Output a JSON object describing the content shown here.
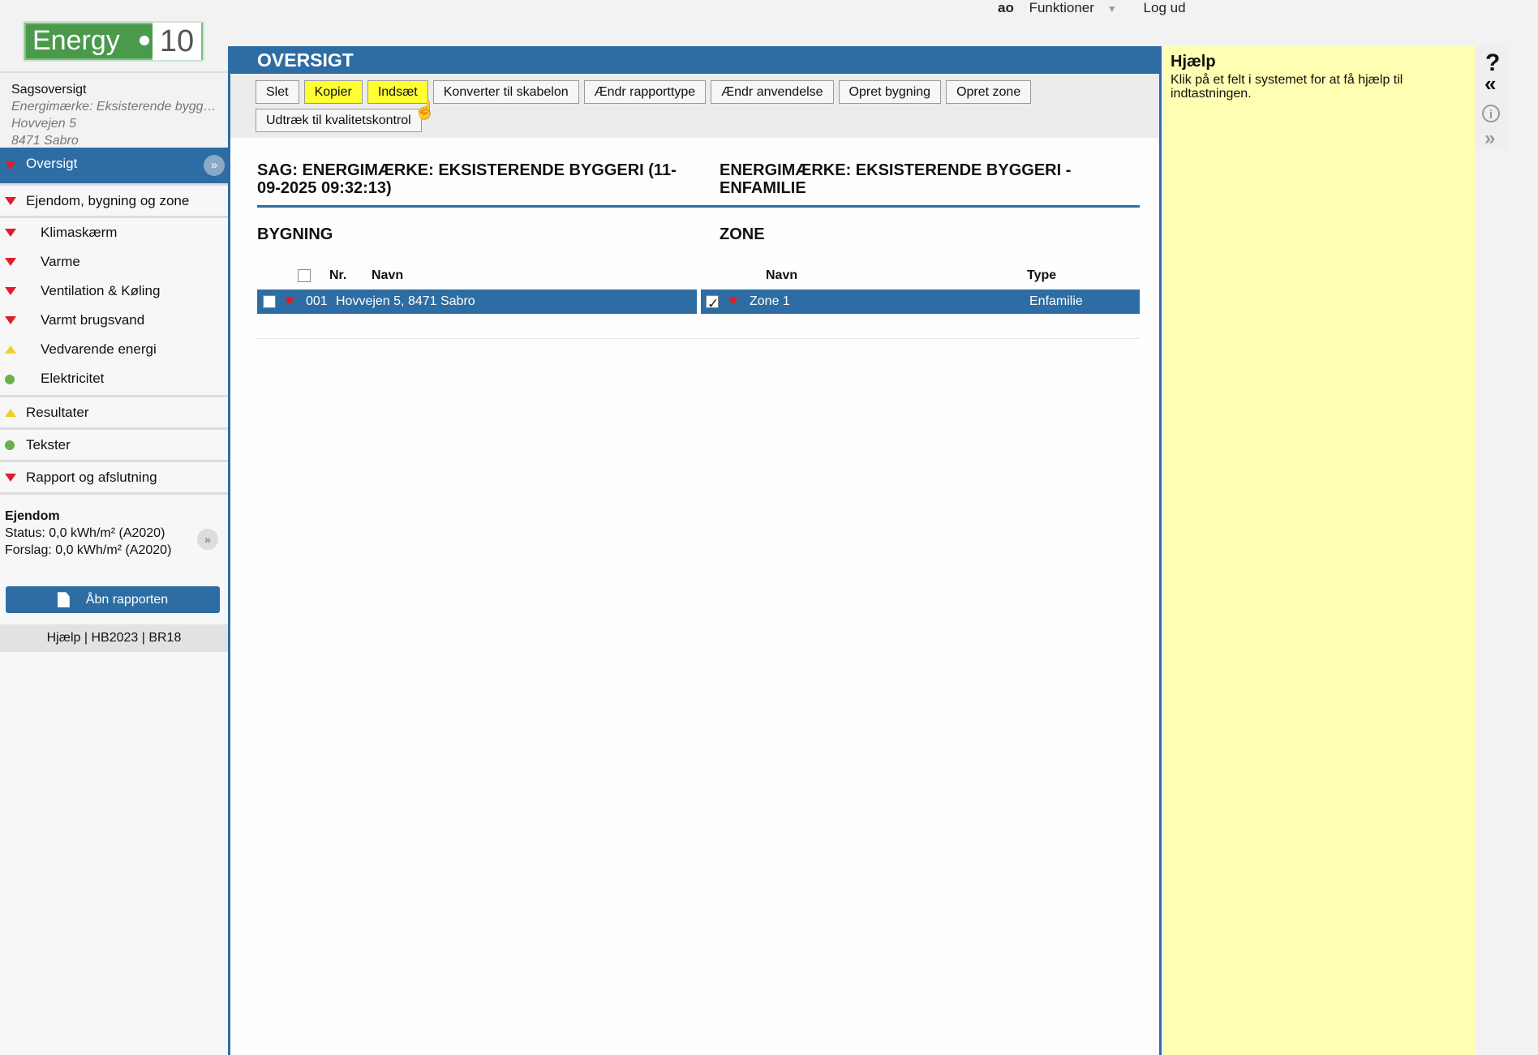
{
  "topbar": {
    "user": "ao",
    "functions": "Funktioner",
    "logout": "Log ud"
  },
  "logo": {
    "word": "Energy",
    "number": "10"
  },
  "case": {
    "title": "Sagsoversigt",
    "subtitle": "Energimærke: Eksisterende bygg…",
    "address1": "Hovvejen 5",
    "address2": "8471 Sabro"
  },
  "nav": {
    "oversigt": "Oversigt",
    "ejendom": "Ejendom, bygning og zone",
    "klimaskaerm": "Klimaskærm",
    "varme": "Varme",
    "ventilation": "Ventilation & Køling",
    "varmt": "Varmt brugsvand",
    "vedvarende": "Vedvarende energi",
    "elektricitet": "Elektricitet",
    "resultater": "Resultater",
    "tekster": "Tekster",
    "rapport": "Rapport og afslutning"
  },
  "property": {
    "heading": "Ejendom",
    "status": "Status: 0,0 kWh/m² (A2020)",
    "forslag": "Forslag: 0,0 kWh/m² (A2020)"
  },
  "open_report": "Åbn rapporten",
  "footer_links": "Hjælp | HB2023 | BR18",
  "main": {
    "header": "OVERSIGT",
    "buttons": {
      "slet": "Slet",
      "kopier": "Kopier",
      "indsaet": "Indsæt",
      "konverter": "Konverter til skabelon",
      "rapporttype": "Ændr rapporttype",
      "anvendelse": "Ændr anvendelse",
      "opret_bygning": "Opret bygning",
      "opret_zone": "Opret zone",
      "udtraek": "Udtræk til kvalitetskontrol"
    },
    "title_left": "SAG: ENERGIMÆRKE: EKSISTERENDE BYGGERI (11-09-2025 09:32:13)",
    "title_right": "ENERGIMÆRKE: EKSISTERENDE BYGGERI - ENFAMILIE",
    "section_bygning": "BYGNING",
    "section_zone": "ZONE",
    "col_nr": "Nr.",
    "col_navn": "Navn",
    "col_zone_navn": "Navn",
    "col_type": "Type",
    "building_row": {
      "nr": "001",
      "navn": "Hovvejen 5, 8471 Sabro"
    },
    "zone_row": {
      "navn": "Zone 1",
      "type": "Enfamilie"
    }
  },
  "help": {
    "title": "Hjælp",
    "body": "Klik på et felt i systemet for at få hjælp til indtastningen."
  },
  "colors": {
    "primary": "#2d6da3",
    "highlight": "#ffff33",
    "help_bg": "#ffffb3",
    "red": "#e11c2a",
    "yellow": "#f2cf22",
    "green": "#6ab04c"
  }
}
